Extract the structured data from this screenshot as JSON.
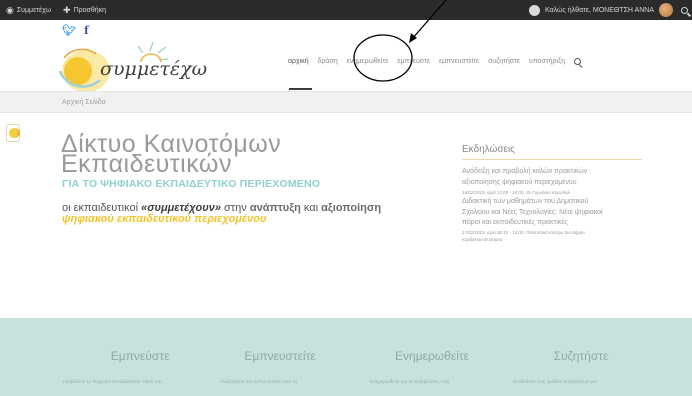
{
  "adminbar": {
    "site_label": "Συμμετέχω",
    "add_label": "Προσθήκη",
    "greeting": "Καλώς ήλθατε, ΜΟΝΕΘΤΣΗ ΑΝΝΑ"
  },
  "logo": {
    "text": "συμμετέχω"
  },
  "nav": {
    "items": [
      "αρχική",
      "δράση",
      "ενημερωθείτε",
      "εμπνευστε",
      "εμπνευστείτε",
      "συζητήστε",
      "υποστήριξη"
    ]
  },
  "breadcrumb": "Αρχική Σελίδα",
  "hero": {
    "title_line1": "Δίκτυο Καινοτόμων",
    "title_line2": "Εκπαιδευτικών",
    "subtitle": "ΓΙΑ ΤΟ ΨΗΦΙΑΚΟ ΕΚΠΑΙΔΕΥΤΙΚΟ ΠΕΡΙΕΧΟΜΕΝΟ",
    "t1": "οι εκπαιδευτικοί ",
    "t2": "«συμμετέχουν»",
    "t3": " στην ",
    "t4": "ανάπτυξη",
    "t5": " και ",
    "t6": "αξιοποίηση",
    "t7": "ψηφιακού εκπαιδευτικού περιεχομένου"
  },
  "events": {
    "title": "Εκδηλώσεις",
    "items": [
      {
        "line1": "Ανάδειξη και προβολή καλών πρακτικών",
        "line2": "αξιοποίησης ψηφιακού περιεχομένου",
        "date": "16/02/2019, ώρα 12:00 - 15:00, 3ο Γυμνάσιο Κορυδαλ"
      },
      {
        "line1": "Διδακτική των μαθημάτων του Δημοτικού",
        "line2": "Σχολείου και Νέες Τεχνολογίες: Νέοι ψηφιακοί",
        "line3": "πόροι και εκπαιδευτικές πρακτικές",
        "date1": "17/02/2019, ώρα 08:15 - 14:00, Πολιτιστικό Κέντρο του Δήμου",
        "date2": "Κορδελιού-Ευόσμου"
      }
    ]
  },
  "footer": {
    "cols": [
      {
        "title": "Εμπνεύστε",
        "text": "Υποβάλετε το Ψηφιακό Εκπαιδευτικό Υλικό σας"
      },
      {
        "title": "Εμπνευστείτε",
        "text": "Αναζητήστε και εμπνευστείτε από τα"
      },
      {
        "title": "Ενημερωθείτε",
        "text": "Ενημερωθείτε για τις εκδηλώσεις που"
      },
      {
        "title": "Συζητήστε",
        "text": "Συνδεθείτε στις ομάδες συζητήσεων για"
      }
    ]
  },
  "colors": {
    "adminbar": "#2b2b2b",
    "accent_teal": "#90d0cf",
    "accent_yellow": "#f3c32a",
    "footer_band": "#c9e1dd"
  }
}
